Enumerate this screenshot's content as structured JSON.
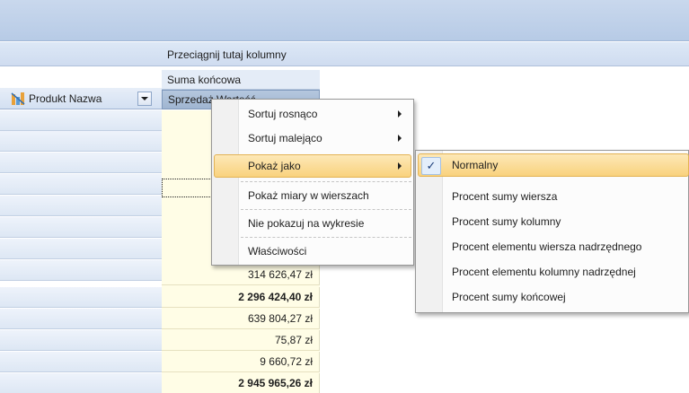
{
  "pivot": {
    "column_drop_text": "Przeciągnij tutaj kolumny",
    "grand_total_header": "Suma końcowa",
    "measure_header": "Sprzedaż Wartość",
    "row_field_label": "Produkt Nazwa",
    "visible_values": [
      "314 626,47 zł",
      "2 296 424,40 zł",
      "639 804,27 zł",
      "75,87 zł",
      "9 660,72 zł",
      "2 945 965,26 zł"
    ],
    "bold_values": [
      false,
      true,
      false,
      false,
      false,
      true
    ]
  },
  "context_menu": {
    "items": [
      {
        "label": "Sortuj rosnąco",
        "has_submenu": true
      },
      {
        "label": "Sortuj malejąco",
        "has_submenu": true
      },
      {
        "label": "Pokaż jako",
        "has_submenu": true,
        "highlighted": true
      },
      {
        "label": "Pokaż miary w wierszach"
      },
      {
        "label": "Nie pokazuj na wykresie"
      },
      {
        "label": "Właściwości"
      }
    ]
  },
  "submenu": {
    "items": [
      {
        "label": "Normalny",
        "checked": true,
        "highlighted": true
      },
      {
        "label": "Procent sumy wiersza"
      },
      {
        "label": "Procent sumy kolumny"
      },
      {
        "label": "Procent elementu wiersza nadrzędnego"
      },
      {
        "label": "Procent elementu kolumny nadrzędnej"
      },
      {
        "label": "Procent sumy końcowej"
      }
    ]
  },
  "icons": {
    "product_field": "dimension-chart-icon",
    "filter": "dropdown-arrow-icon",
    "submenu_arrow": "chevron-right-icon",
    "check": "check-icon"
  },
  "colors": {
    "values_background": "#fffde6",
    "highlight": "#f9d27d",
    "header_blue": "#b7cbe6"
  }
}
